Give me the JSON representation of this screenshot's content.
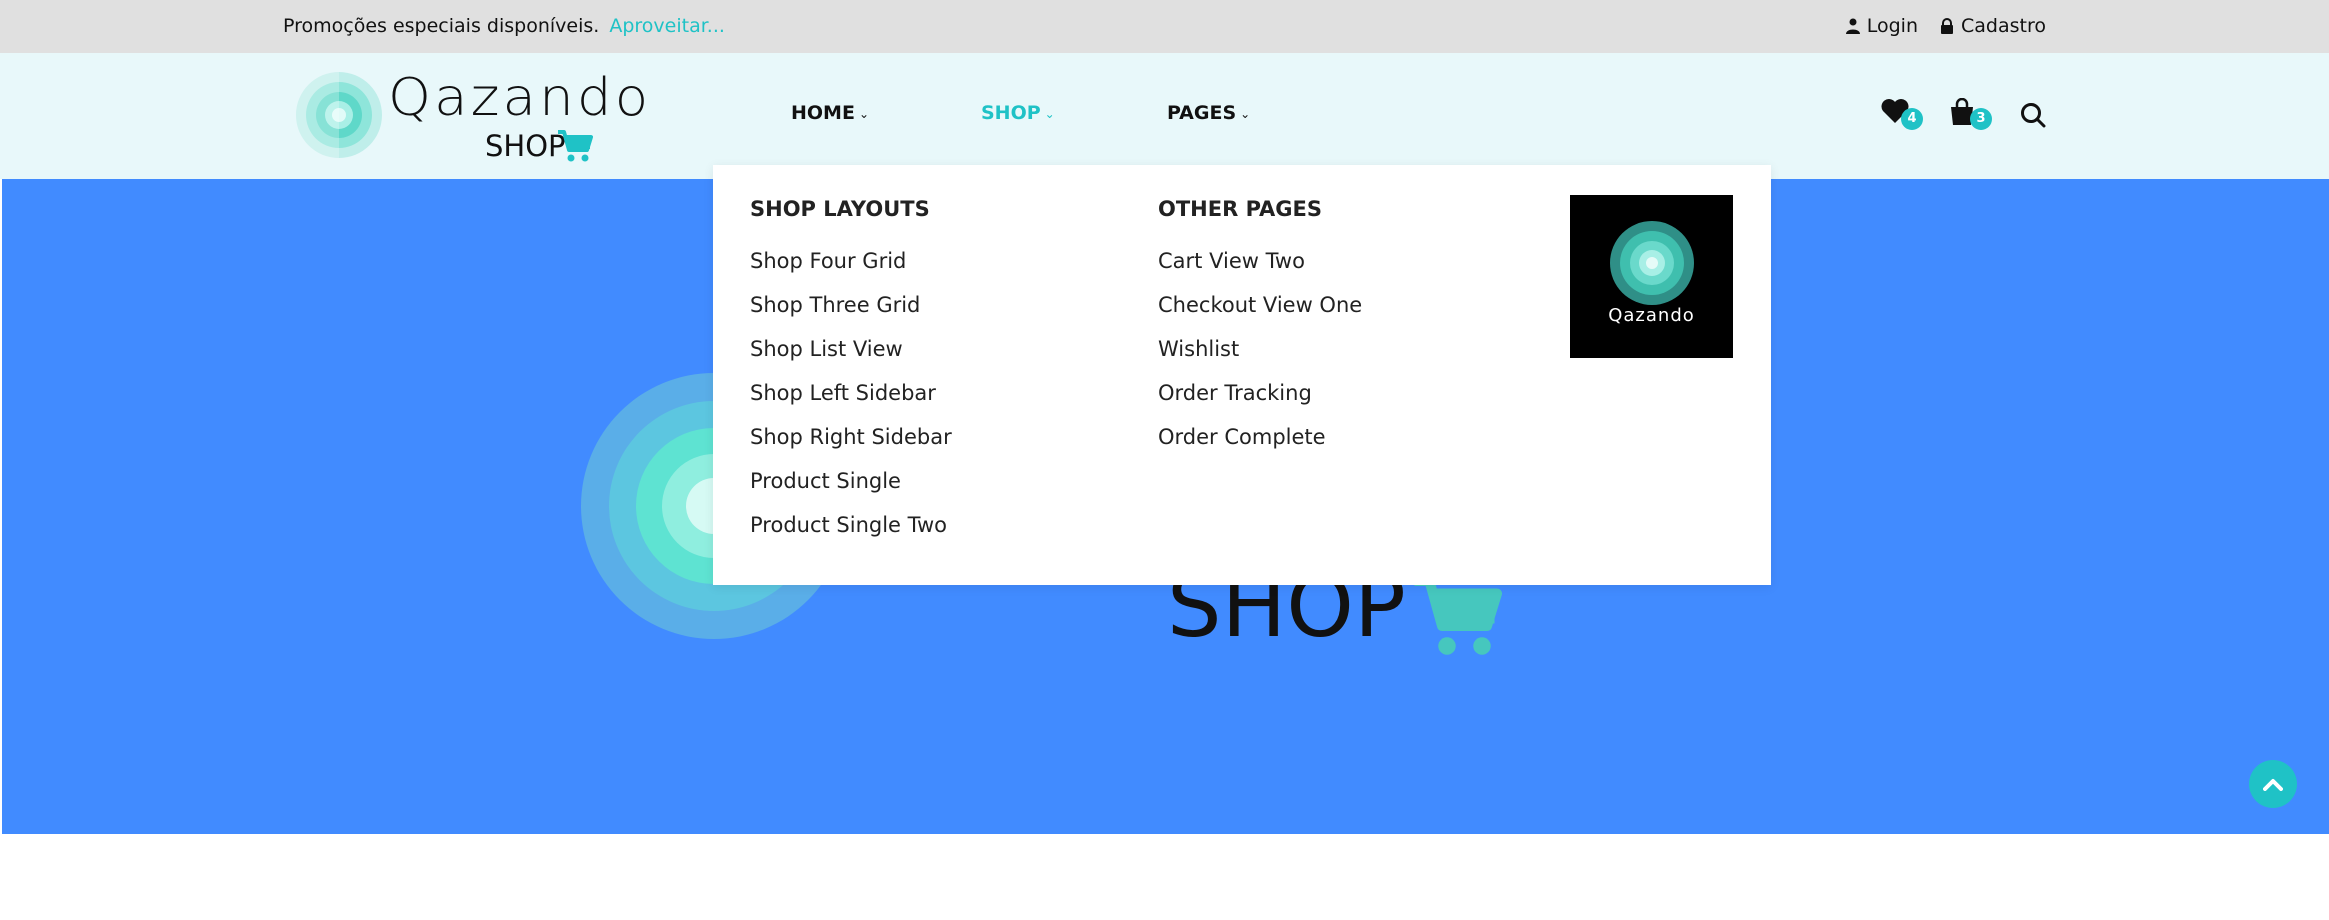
{
  "topbar": {
    "promo_text": "Promoções especiais disponíveis.",
    "promo_link": "Aproveitar...",
    "login": "Login",
    "register": "Cadastro"
  },
  "logo": {
    "word": "Qazando",
    "sub": "SHOP"
  },
  "nav": {
    "items": [
      {
        "label": "HOME",
        "active": false
      },
      {
        "label": "SHOP",
        "active": true
      },
      {
        "label": "PAGES",
        "active": false
      }
    ]
  },
  "header_icons": {
    "wishlist_count": "4",
    "cart_count": "3"
  },
  "mega_menu": {
    "col1_title": "SHOP LAYOUTS",
    "col1_items": [
      "Shop Four Grid",
      "Shop Three Grid",
      "Shop List View",
      "Shop Left Sidebar",
      "Shop Right Sidebar",
      "Product Single",
      "Product Single Two"
    ],
    "col2_title": "OTHER PAGES",
    "col2_items": [
      "Cart View Two",
      "Checkout View One",
      "Wishlist",
      "Order Tracking",
      "Order Complete"
    ],
    "promo_caption": "Qazando"
  },
  "hero": {
    "shop_text": "SHOP"
  },
  "colors": {
    "accent": "#1fc2c6",
    "hero_bg": "#418bff",
    "topbar_bg": "#e0e0e0",
    "header_bg": "#e8f8fa"
  }
}
